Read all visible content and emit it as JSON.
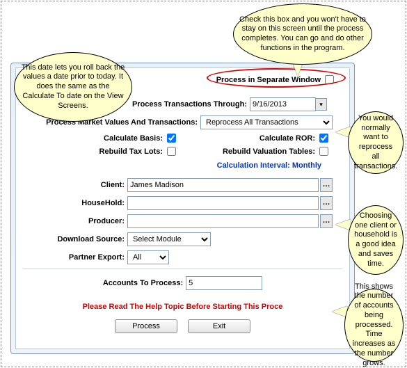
{
  "callouts": {
    "top": "Check this box and you won't have to stay on this screen until the process completes.  You can go and do other functions in the program.",
    "left": "This date lets you roll back the values a date prior to today.  It does the same as the Calculate To date on the View Screens.",
    "right1": "You would normally want to reprocess all transactions.",
    "right2": "Choosing one client or household is a good idea and saves time.",
    "right3": "This shows the number of accounts being processed.  Time increases as the number grows."
  },
  "form": {
    "separate_window_label": "Process in Separate Window",
    "separate_window_checked": false,
    "through_label": "Process Transactions Through:",
    "through_value": "9/16/2013",
    "market_label": "Process Market Values And Transactions:",
    "market_value": "Reprocess All Transactions",
    "calc_basis_label": "Calculate Basis:",
    "calc_basis_checked": true,
    "calc_ror_label": "Calculate ROR:",
    "calc_ror_checked": true,
    "rebuild_tax_label": "Rebuild Tax Lots:",
    "rebuild_tax_checked": false,
    "rebuild_val_label": "Rebuild Valuation Tables:",
    "rebuild_val_checked": false,
    "calc_interval": "Calculation Interval: Monthly",
    "client_label": "Client:",
    "client_value": "James Madison",
    "household_label": "HouseHold:",
    "household_value": "",
    "producer_label": "Producer:",
    "producer_value": "",
    "download_label": "Download Source:",
    "download_value": "Select Module",
    "partner_label": "Partner Export:",
    "partner_value": "All",
    "accounts_label": "Accounts To Process:",
    "accounts_value": "5",
    "warning": "Please Read The Help Topic Before Starting This Proce",
    "process_btn": "Process",
    "exit_btn": "Exit"
  }
}
